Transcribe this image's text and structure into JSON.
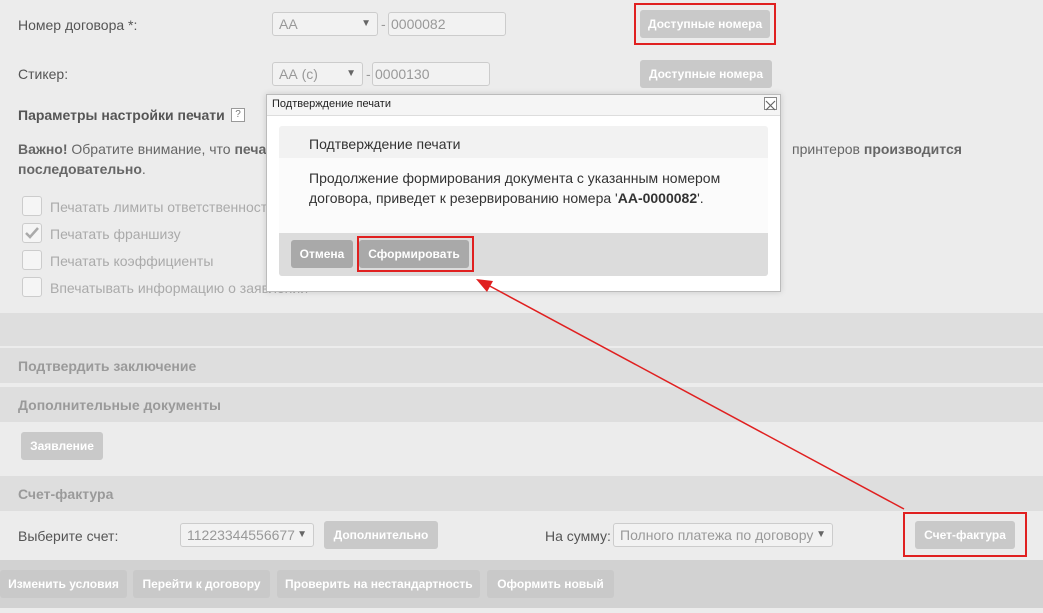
{
  "contract": {
    "label": "Номер договора *:",
    "series": "АА",
    "number": "0000082",
    "dash": "-",
    "available_button": "Доступные номера"
  },
  "sticker": {
    "label": "Стикер:",
    "series": "АА (с)",
    "number": "0000130",
    "dash": "-",
    "available_button": "Доступные номера"
  },
  "print_settings": {
    "title": "Параметры настройки печати",
    "help": "?",
    "warning_bold": "Важно!",
    "warning_text": " Обратите внимание, что ",
    "warning_bold2": "печа",
    "warning_right": "принтеров ",
    "warning_right_bold": "производится",
    "warning_line2_bold": "последовательно",
    "warning_line2_end": ".",
    "options": [
      {
        "label": "Печатать лимиты ответственност",
        "checked": false
      },
      {
        "label": "Печатать франшизу",
        "checked": true
      },
      {
        "label": "Печатать коэффициенты",
        "checked": false
      },
      {
        "label": "Впечатывать информацию о заявлении",
        "checked": false
      }
    ]
  },
  "sections": {
    "confirm": "Подтвердить заключение",
    "additional_docs": "Дополнительные документы",
    "application_button": "Заявление",
    "invoice": "Счет-фактура"
  },
  "invoice_row": {
    "choose_label": "Выберите счет:",
    "account": "11223344556677",
    "more_button": "Дополнительно",
    "sum_label": "На сумму:",
    "sum_value": "Полного платежа по договору",
    "invoice_button": "Счет-фактура"
  },
  "bottom_buttons": [
    "Изменить условия",
    "Перейти к договору",
    "Проверить на нестандартность",
    "Оформить новый"
  ],
  "modal": {
    "window_title": "Подтверждение печати",
    "title": "Подтверждение печати",
    "text_line1": "Продолжение формирования документа с указанным номером",
    "text_line2_pre": "договора, приведет к резервированию номера '",
    "text_number": "АА-0000082",
    "text_line2_post": "'.",
    "cancel_button": "Отмена",
    "form_button": "Сформировать"
  },
  "colors": {
    "highlight": "#e02020",
    "button": "#c9c9c9",
    "button_dark": "#a9a9a9"
  }
}
